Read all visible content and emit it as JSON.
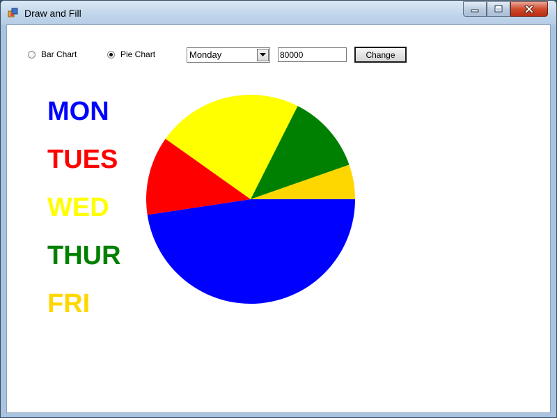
{
  "window": {
    "title": "Draw and Fill"
  },
  "controls": {
    "radio_bar_label": "Bar Chart",
    "radio_pie_label": "Pie Chart",
    "selected_chart": "pie",
    "day_select_value": "Monday",
    "value_input": "80000",
    "change_button_label": "Change"
  },
  "legend": {
    "items": [
      {
        "label": "MON",
        "color": "#0000ff"
      },
      {
        "label": "TUES",
        "color": "#ff0000"
      },
      {
        "label": "WED",
        "color": "#ffff00"
      },
      {
        "label": "THUR",
        "color": "#008000"
      },
      {
        "label": "FRI",
        "color": "#ffd700"
      }
    ]
  },
  "chart_data": {
    "type": "pie",
    "start_angle_deg": 0,
    "direction": "clockwise",
    "slices": [
      {
        "category": "MON",
        "value": 80000,
        "color": "#0000ff"
      },
      {
        "category": "TUES",
        "value": 20500,
        "color": "#ff0000"
      },
      {
        "category": "WED",
        "value": 38000,
        "color": "#ffff00"
      },
      {
        "category": "THUR",
        "value": 20500,
        "color": "#008000"
      },
      {
        "category": "FRI",
        "value": 9000,
        "color": "#ffd700"
      }
    ]
  }
}
